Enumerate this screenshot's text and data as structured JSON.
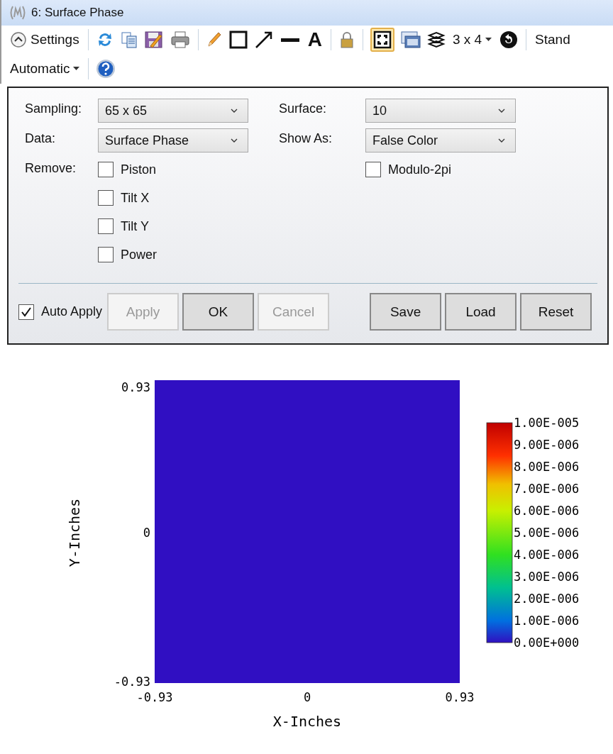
{
  "window": {
    "title": "6: Surface Phase"
  },
  "toolbar": {
    "settings": "Settings",
    "text_tool": "A",
    "frame_toggle": {
      "on": true
    },
    "layout": "3 x 4",
    "standard": "Stand",
    "scale": "Automatic"
  },
  "settings": {
    "fields": [
      {
        "label": "Sampling:",
        "value": "65 x 65"
      },
      {
        "label": "Surface:",
        "value": "10"
      },
      {
        "label": "Data:",
        "value": "Surface Phase"
      },
      {
        "label": "Show As:",
        "value": "False Color"
      }
    ],
    "remove_label": "Remove:",
    "remove": [
      {
        "label": "Piston",
        "checked": false
      },
      {
        "label": "Tilt X",
        "checked": false
      },
      {
        "label": "Tilt Y",
        "checked": false
      },
      {
        "label": "Power",
        "checked": false
      }
    ],
    "modulo": {
      "label": "Modulo-2pi",
      "checked": false
    },
    "auto_apply": {
      "label": "Auto Apply",
      "checked": true
    },
    "buttons": [
      {
        "label": "Apply",
        "disabled": true
      },
      {
        "label": "OK",
        "disabled": false
      },
      {
        "label": "Cancel",
        "disabled": true
      },
      {
        "label": "Save",
        "disabled": false
      },
      {
        "label": "Load",
        "disabled": false
      },
      {
        "label": "Reset",
        "disabled": false
      }
    ]
  },
  "plot": {
    "ylabel": "Y-Inches",
    "xlabel": "X-Inches",
    "y_ticks": [
      "0.93",
      "0",
      "-0.93"
    ],
    "x_ticks": [
      "-0.93",
      "0",
      "0.93"
    ],
    "legend_labels": [
      "1.00E-005",
      "9.00E-006",
      "8.00E-006",
      "7.00E-006",
      "6.00E-006",
      "5.00E-006",
      "4.00E-006",
      "3.00E-006",
      "2.00E-006",
      "1.00E-006",
      "0.00E+000"
    ]
  }
}
